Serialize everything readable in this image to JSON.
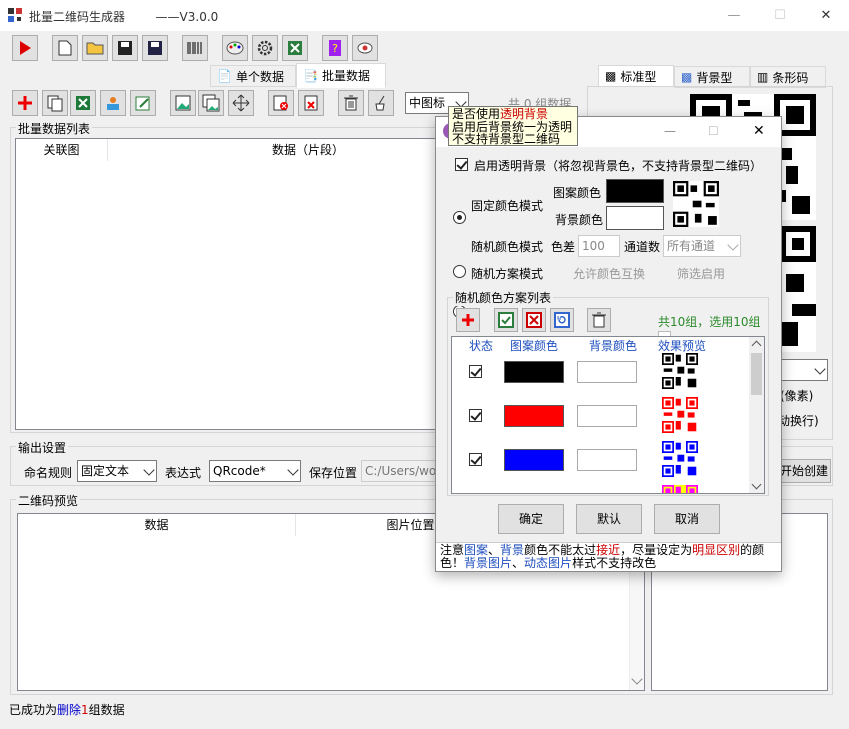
{
  "app": {
    "title": "批量二维码生成器",
    "version": "——V3.0.0"
  },
  "window": {
    "minimize": "—",
    "maximize": "☐",
    "close": "✕"
  },
  "tabs_main": {
    "single": "单个数据",
    "batch": "批量数据"
  },
  "tabs_right": {
    "standard": "标准型",
    "background": "背景型",
    "barcode": "条形码"
  },
  "toolbar2": {
    "view_select": "中图标",
    "count_label": "共 0 组数据"
  },
  "batch_list": {
    "title": "批量数据列表",
    "col_relation": "关联图",
    "col_data": "数据（片段）"
  },
  "output": {
    "title": "输出设置",
    "naming_label": "命名规则",
    "naming_value": "固定文本",
    "expr_label": "表达式",
    "expr_value": "QRcode*",
    "save_label": "保存位置",
    "save_path": "C:/Users/wo",
    "start_btn": "开始创建"
  },
  "preview": {
    "title": "二维码预览",
    "col_data": "数据",
    "col_imgpos": "图片位置"
  },
  "right": {
    "pixel_label": "(像素)",
    "wrap_label": "动换行)"
  },
  "status": {
    "prefix": "已成功为",
    "action": "删除",
    "count": "1",
    "suffix": "组数据"
  },
  "tooltip": {
    "line1a": "是否使用",
    "line1b": "透明背景",
    "line2": "启用后背景统一为透明",
    "line3": "不支持背景型二维码"
  },
  "dialog": {
    "transparent_label": "启用透明背景（将忽视背景色，不支持背景型二维码）",
    "fixed_mode": "固定颜色模式",
    "pattern_color_label": "图案颜色",
    "bg_color_label": "背景颜色",
    "random_mode": "随机颜色模式",
    "diff_label": "色差",
    "diff_value": "100",
    "channel_label": "通道数",
    "channel_value": "所有通道",
    "scheme_mode": "随机方案模式",
    "allow_swap": "允许颜色互换",
    "filter_enable": "筛选启用",
    "list_title": "随机颜色方案列表",
    "list_count": "共10组，选用10组",
    "col_state": "状态",
    "col_pattern": "图案颜色",
    "col_bg": "背景颜色",
    "col_preview": "效果预览",
    "rows": [
      {
        "pattern": "#000000",
        "bg": "#ffffff"
      },
      {
        "pattern": "#ff0000",
        "bg": "#ffffff"
      },
      {
        "pattern": "#0000ff",
        "bg": "#ffffff"
      },
      {
        "pattern": "#ff00ff",
        "bg": "#ffff00"
      }
    ],
    "ok": "确定",
    "default": "默认",
    "cancel": "取消",
    "notice_p1": "注意",
    "notice_pattern": "图案",
    "notice_sep": "、",
    "notice_bg": "背景",
    "notice_p2": "颜色不能太过",
    "notice_close": "接近",
    "notice_p3": "，尽量设定为",
    "notice_distinct": "明显区别",
    "notice_p4": "的颜",
    "notice_p5": "色！",
    "notice_bgimg": "背景图片",
    "notice_anim": "动态图片",
    "notice_p6": "样式不支持改色"
  }
}
